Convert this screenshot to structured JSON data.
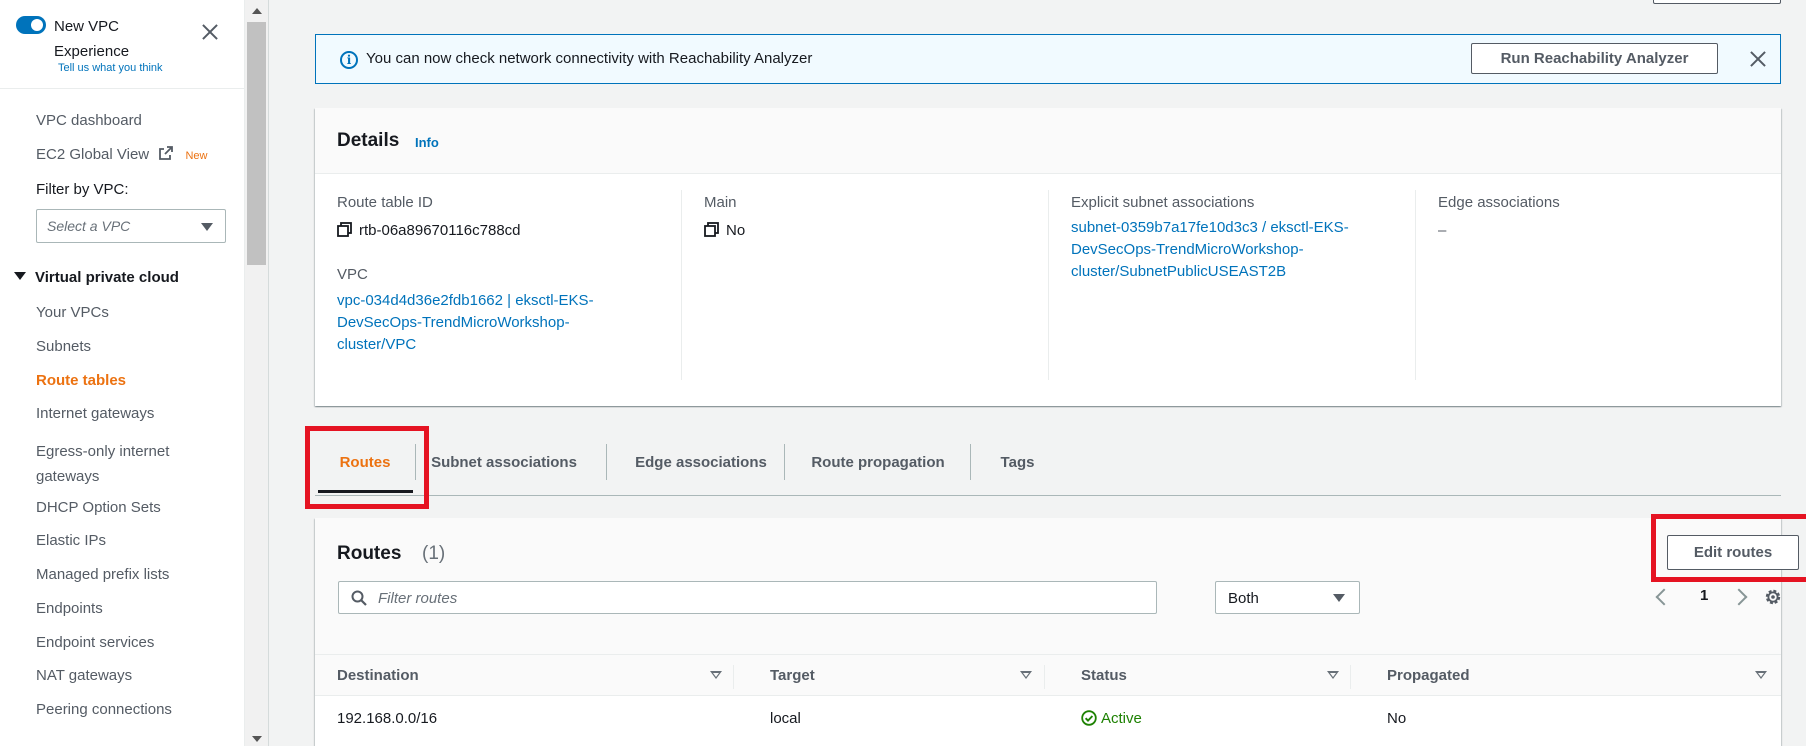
{
  "sidebar": {
    "new_vpc_label": "New VPC Experience",
    "tell_us": "Tell us what you think",
    "items_top": [
      {
        "label": "VPC dashboard"
      },
      {
        "label": "EC2 Global View",
        "badge": "New"
      }
    ],
    "filter_label": "Filter by VPC:",
    "filter_placeholder": "Select a VPC",
    "section": "Virtual private cloud",
    "items": [
      {
        "label": "Your VPCs"
      },
      {
        "label": "Subnets"
      },
      {
        "label": "Route tables"
      },
      {
        "label": "Internet gateways"
      },
      {
        "label": "Egress-only internet gateways"
      },
      {
        "label": "DHCP Option Sets"
      },
      {
        "label": "Elastic IPs"
      },
      {
        "label": "Managed prefix lists"
      },
      {
        "label": "Endpoints"
      },
      {
        "label": "Endpoint services"
      },
      {
        "label": "NAT gateways"
      },
      {
        "label": "Peering connections"
      }
    ]
  },
  "flash": {
    "message": "You can now check network connectivity with Reachability Analyzer",
    "button": "Run Reachability Analyzer"
  },
  "details": {
    "title": "Details",
    "info": "Info",
    "route_table_id_label": "Route table ID",
    "route_table_id": "rtb-06a89670116c788cd",
    "vpc_label": "VPC",
    "vpc_value": "vpc-034d4d36e2fdb1662 | eksctl-EKS-DevSecOps-TrendMicroWorkshop-cluster/VPC",
    "main_label": "Main",
    "main_value": "No",
    "explicit_label": "Explicit subnet associations",
    "explicit_value": "subnet-0359b7a17fe10d3c3 / eksctl-EKS-DevSecOps-TrendMicroWorkshop-cluster/SubnetPublicUSEAST2B",
    "edge_label": "Edge associations",
    "edge_value": "–"
  },
  "tabs": [
    {
      "label": "Routes"
    },
    {
      "label": "Subnet associations"
    },
    {
      "label": "Edge associations"
    },
    {
      "label": "Route propagation"
    },
    {
      "label": "Tags"
    }
  ],
  "routes": {
    "title": "Routes",
    "count": "(1)",
    "edit_button": "Edit routes",
    "search_placeholder": "Filter routes",
    "filter_value": "Both",
    "page": "1",
    "columns": [
      "Destination",
      "Target",
      "Status",
      "Propagated"
    ],
    "rows": [
      {
        "destination": "192.168.0.0/16",
        "target": "local",
        "status": "Active",
        "propagated": "No"
      }
    ]
  },
  "colors": {
    "accent": "#ec7211",
    "link": "#0073bb",
    "highlight_box": "#e51322",
    "status_active": "#1d8102"
  }
}
